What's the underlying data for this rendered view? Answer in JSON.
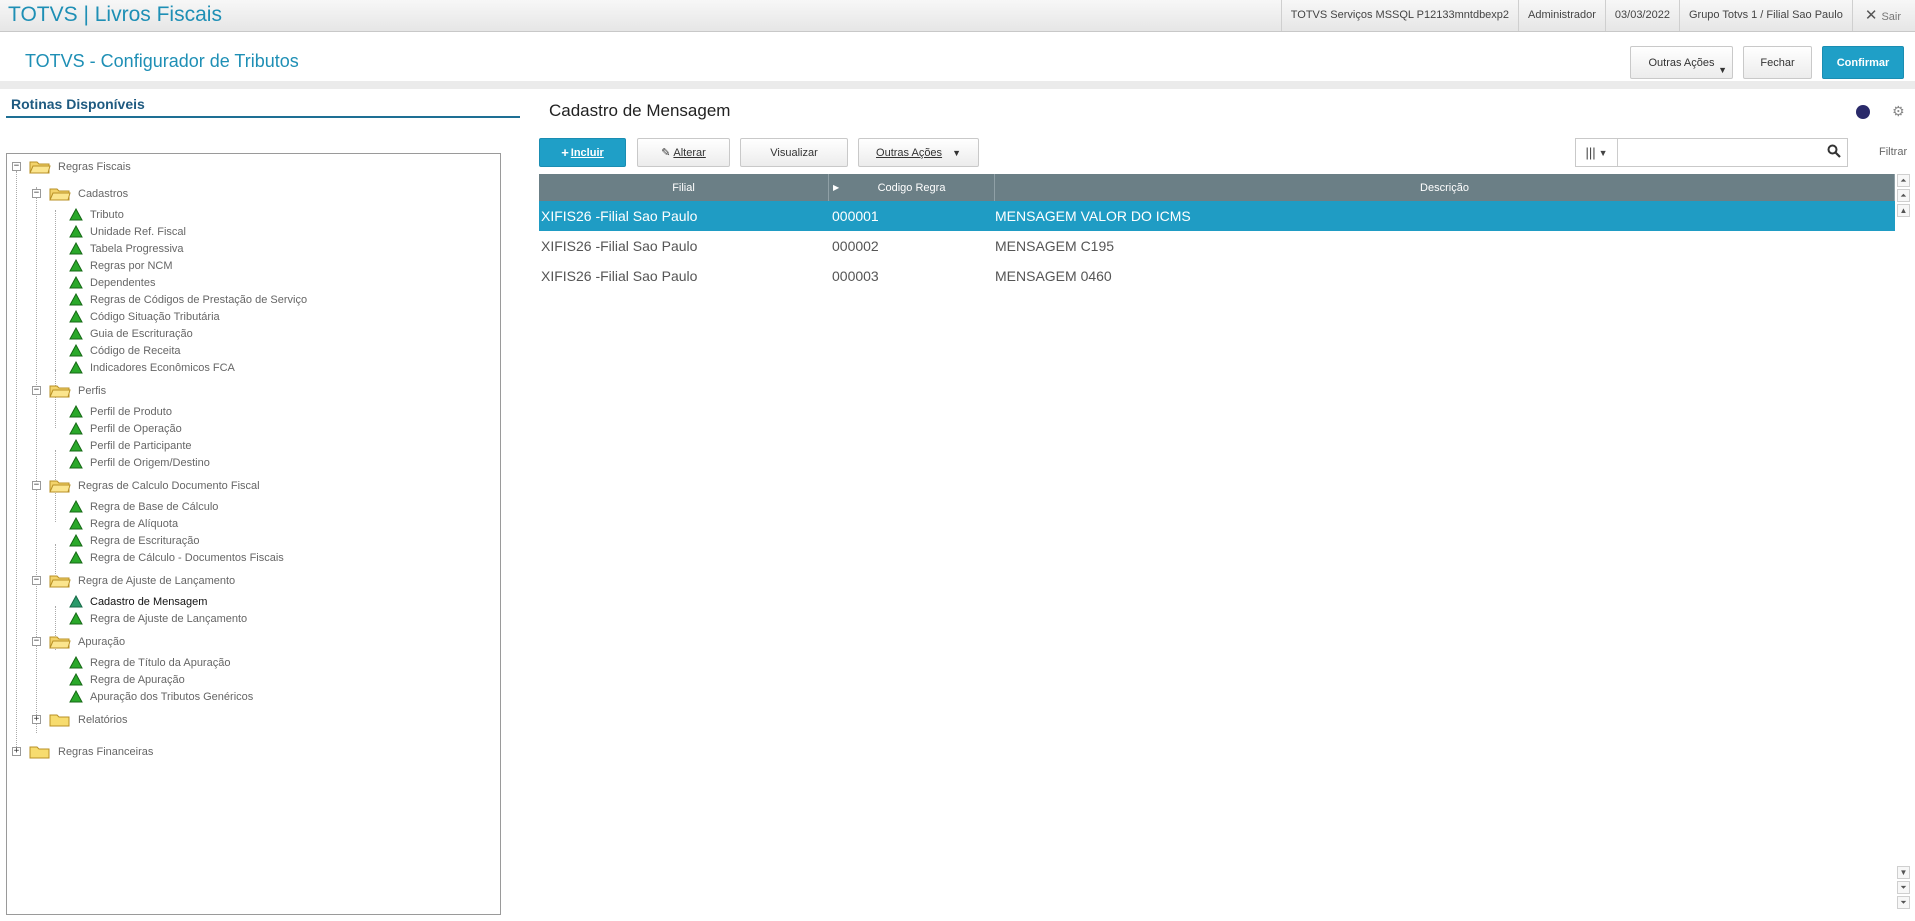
{
  "topbar": {
    "app_title": "TOTVS | Livros Fiscais",
    "server": "TOTVS Serviços MSSQL P12133mntdbexp2",
    "user": "Administrador",
    "date": "03/03/2022",
    "branch": "Grupo Totvs 1 / Filial Sao Paulo",
    "exit_label": "Sair"
  },
  "header": {
    "title": "TOTVS - Configurador de Tributos",
    "other_actions": "Outras Ações",
    "close": "Fechar",
    "confirm": "Confirmar"
  },
  "sidebar": {
    "title": "Rotinas Disponíveis",
    "root1": "Regras Fiscais",
    "cadastros": "Cadastros",
    "cadastros_items": [
      "Tributo",
      "Unidade Ref. Fiscal",
      "Tabela Progressiva",
      "Regras por NCM",
      "Dependentes",
      "Regras de Códigos de Prestação de Serviço",
      "Código Situação Tributária",
      "Guia de Escrituração",
      "Código de Receita",
      "Indicadores Econômicos FCA"
    ],
    "perfis": "Perfis",
    "perfis_items": [
      "Perfil de Produto",
      "Perfil de Operação",
      "Perfil de Participante",
      "Perfil de Origem/Destino"
    ],
    "calc": "Regras de Calculo Documento Fiscal",
    "calc_items": [
      "Regra de Base de Cálculo",
      "Regra de Alíquota",
      "Regra de Escrituração",
      "Regra de Cálculo - Documentos Fiscais"
    ],
    "ajuste": "Regra de Ajuste de Lançamento",
    "ajuste_items": [
      "Cadastro de Mensagem",
      "Regra de Ajuste de Lançamento"
    ],
    "apuracao": "Apuração",
    "apuracao_items": [
      "Regra de Título da Apuração",
      "Regra de Apuração",
      "Apuração dos Tributos Genéricos"
    ],
    "relatorios": "Relatórios",
    "root2": "Regras Financeiras"
  },
  "panel": {
    "title": "Cadastro de Mensagem",
    "btn_incluir": "Incluir",
    "btn_alterar": "Alterar",
    "btn_visualizar": "Visualizar",
    "btn_outras": "Outras Ações",
    "filter_label": "Filtrar",
    "search_value": ""
  },
  "table": {
    "columns": [
      "Filial",
      "Codigo Regra",
      "Descrição"
    ],
    "rows": [
      [
        "XIFIS26 -Filial Sao Paulo",
        "000001",
        "MENSAGEM VALOR DO ICMS"
      ],
      [
        "XIFIS26 -Filial Sao Paulo",
        "000002",
        "MENSAGEM C195"
      ],
      [
        "XIFIS26 -Filial Sao Paulo",
        "000003",
        "MENSAGEM 0460"
      ]
    ]
  },
  "colors": {
    "accent": "#1f9fc7",
    "grid_header": "#6b7f86",
    "selected_row": "#1f9cc4"
  }
}
